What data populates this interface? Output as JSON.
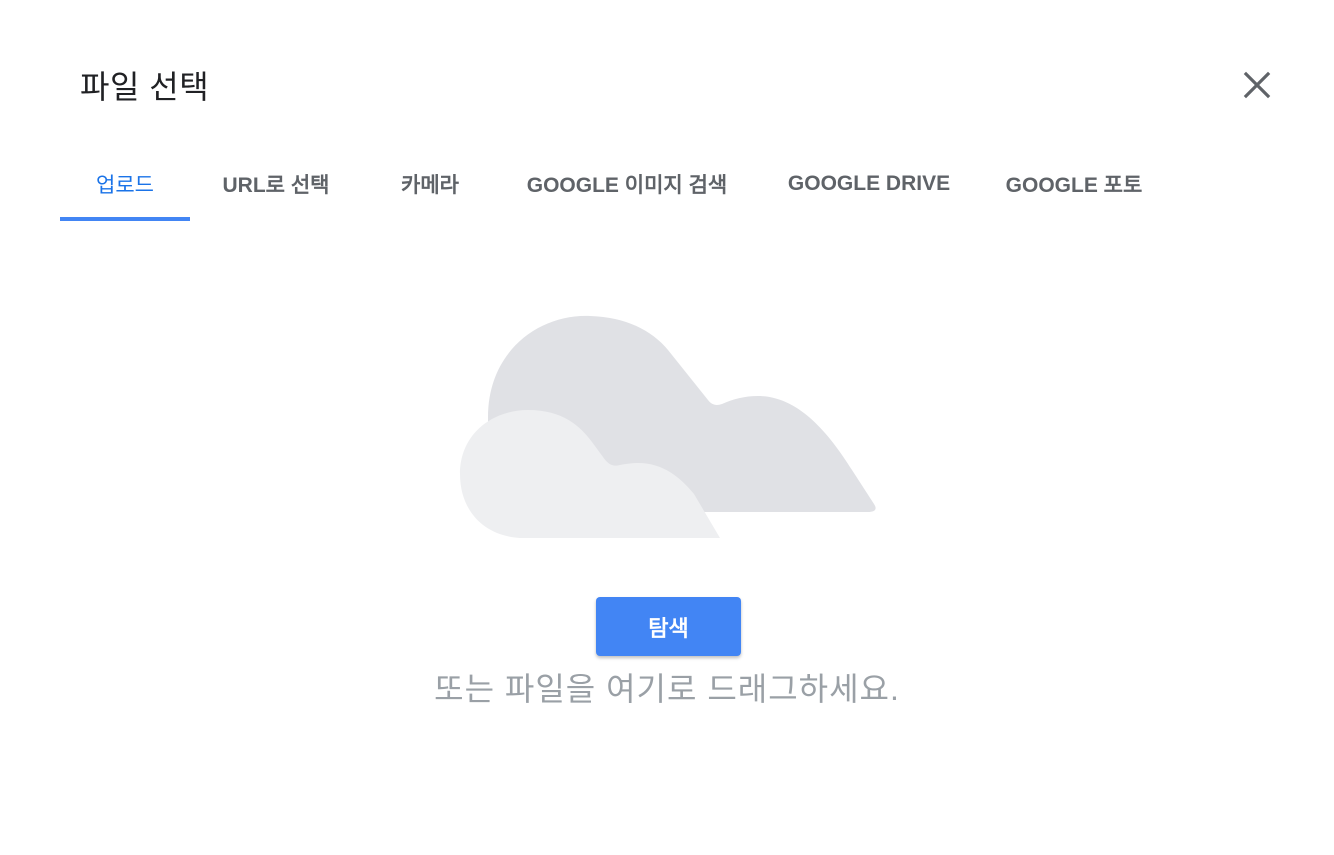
{
  "dialog": {
    "title": "파일 선택",
    "close_icon": "close-icon"
  },
  "tabs": [
    {
      "label": "업로드",
      "active": true
    },
    {
      "label": "URL로 선택",
      "active": false
    },
    {
      "label": "카메라",
      "active": false
    },
    {
      "label": "GOOGLE 이미지 검색",
      "active": false
    },
    {
      "label": "GOOGLE DRIVE",
      "active": false
    },
    {
      "label": "GOOGLE 포토",
      "active": false
    }
  ],
  "upload": {
    "illustration_icon": "cloud-icon",
    "browse_label": "탐색",
    "drag_text": "또는 파일을 여기로 드래그하세요."
  },
  "colors": {
    "accent": "#4285f4",
    "active_tab_text": "#1a73e8",
    "tab_text": "#5f6368",
    "muted_text": "#9aa0a6",
    "cloud_back": "#e0e1e5",
    "cloud_front": "#eeeff1"
  }
}
